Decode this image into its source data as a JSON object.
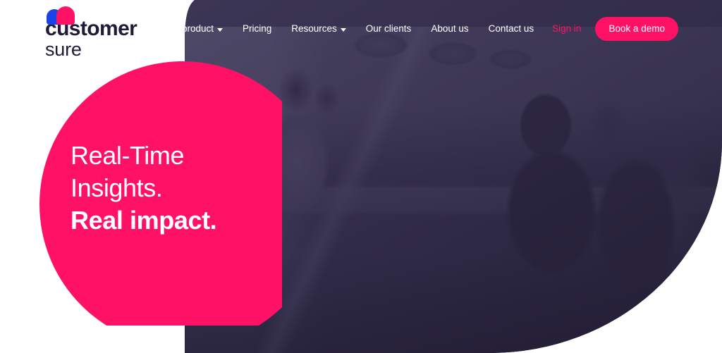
{
  "brand": {
    "logo_line1": "customer",
    "logo_line2": "sure",
    "mark_blue": "#1A43E8",
    "mark_pink": "#FF1266",
    "logo_text_color": "#1F1B38"
  },
  "colors": {
    "accent_pink": "#FF1266",
    "photo_overlay_navy": "#3B3553",
    "page_background": "#FFFFFF",
    "nav_text": "#FFFFFF"
  },
  "nav": {
    "items": [
      {
        "label": "Our product",
        "has_caret": true,
        "style": "light"
      },
      {
        "label": "Pricing",
        "has_caret": false,
        "style": "light"
      },
      {
        "label": "Resources",
        "has_caret": true,
        "style": "light"
      },
      {
        "label": "Our clients",
        "has_caret": false,
        "style": "light"
      },
      {
        "label": "About us",
        "has_caret": false,
        "style": "light"
      },
      {
        "label": "Contact us",
        "has_caret": false,
        "style": "light"
      },
      {
        "label": "Sign in",
        "has_caret": false,
        "style": "pink"
      }
    ],
    "cta_label": "Book a demo"
  },
  "hero": {
    "headline_line1": "Real-Time",
    "headline_line2": "Insights.",
    "headline_line3": "Real impact.",
    "blob_color": "#FF1266",
    "image_alt": "Team meeting around a boardroom table"
  }
}
